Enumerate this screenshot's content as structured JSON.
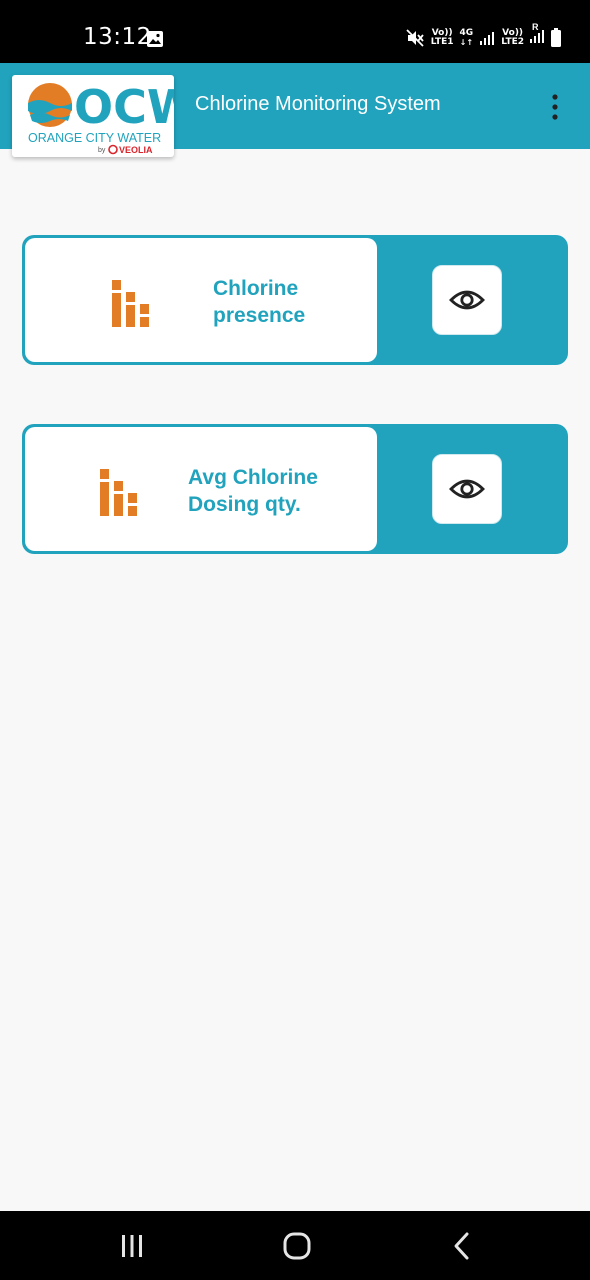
{
  "status_bar": {
    "time": "13:12",
    "sim1": {
      "line1": "Vo))",
      "line2": "LTE1"
    },
    "network": "4G",
    "sim2": {
      "line1": "Vo))",
      "line2": "LTE2"
    },
    "roaming": "R"
  },
  "app_bar": {
    "logo": {
      "wordmark": "OCW",
      "tagline": "ORANGE CITY WATER",
      "by": "by",
      "brand": "VEOLIA"
    },
    "title": "Chlorine Monitoring System"
  },
  "cards": [
    {
      "label_line1": "Chlorine",
      "label_line2": "presence",
      "icon": "bar-chart-icon",
      "action_icon": "eye-icon"
    },
    {
      "label_line1": "Avg Chlorine",
      "label_line2": "Dosing qty.",
      "icon": "bar-chart-icon",
      "action_icon": "eye-icon"
    }
  ],
  "colors": {
    "accent": "#21a3bd",
    "icon_orange": "#e27c25",
    "background": "#f8f8f8"
  },
  "nav_bar": {
    "recent": "recent-apps-icon",
    "home": "home-icon",
    "back": "back-icon"
  }
}
